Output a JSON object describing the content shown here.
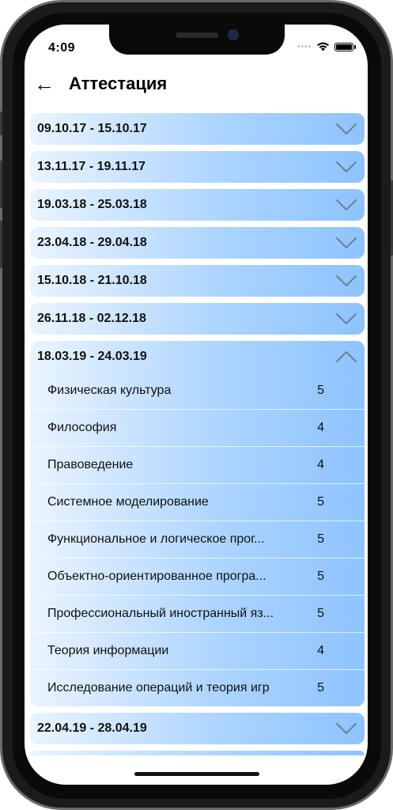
{
  "status": {
    "time": "4:09"
  },
  "header": {
    "back_icon": "←",
    "title": "Аттестация"
  },
  "periods": [
    {
      "label": "09.10.17 - 15.10.17",
      "expanded": false
    },
    {
      "label": "13.11.17 - 19.11.17",
      "expanded": false
    },
    {
      "label": "19.03.18 - 25.03.18",
      "expanded": false
    },
    {
      "label": "23.04.18 - 29.04.18",
      "expanded": false
    },
    {
      "label": "15.10.18 - 21.10.18",
      "expanded": false
    },
    {
      "label": "26.11.18 - 02.12.18",
      "expanded": false
    },
    {
      "label": "18.03.19 - 24.03.19",
      "expanded": true,
      "subjects": [
        {
          "name": "Физическая культура",
          "grade": "5"
        },
        {
          "name": "Философия",
          "grade": "4"
        },
        {
          "name": "Правоведение",
          "grade": "4"
        },
        {
          "name": "Системное моделирование",
          "grade": "5"
        },
        {
          "name": "Функциональное и логическое прог...",
          "grade": "5"
        },
        {
          "name": "Объектно-ориентированное програ...",
          "grade": "5"
        },
        {
          "name": "Профессиональный иностранный яз...",
          "grade": "5"
        },
        {
          "name": "Теория информации",
          "grade": "4"
        },
        {
          "name": "Исследование операций и теория игр",
          "grade": "5"
        }
      ]
    },
    {
      "label": "22.04.19 - 28.04.19",
      "expanded": false
    }
  ],
  "colors": {
    "gradient_start": "#eaf4ff",
    "gradient_end": "#8ec3ff",
    "chevron": "#6f7f94"
  }
}
